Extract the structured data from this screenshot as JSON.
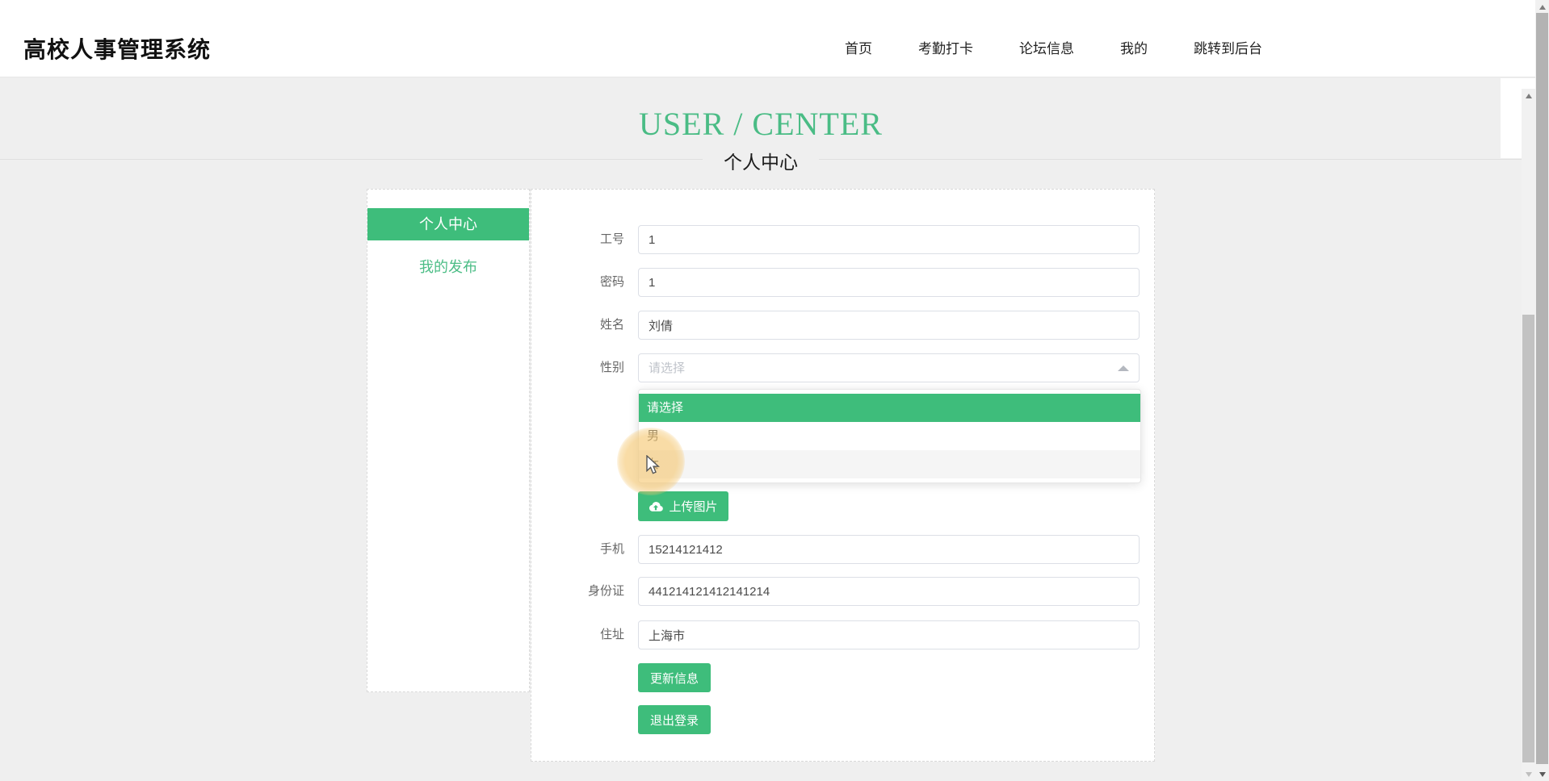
{
  "colors": {
    "accent_green": "#3ebd7b",
    "title_green": "#4abc85",
    "page_bg": "#efefef",
    "hover_option_bg": "#f5f5f5",
    "cursor_highlight": "#f5c770"
  },
  "header": {
    "logo": "高校人事管理系统",
    "nav": [
      {
        "label": "首页"
      },
      {
        "label": "考勤打卡"
      },
      {
        "label": "论坛信息"
      },
      {
        "label": "我的"
      },
      {
        "label": "跳转到后台"
      }
    ]
  },
  "banner": {
    "title": "USER / CENTER",
    "subtitle": "个人中心"
  },
  "sidebar": {
    "items": [
      {
        "label": "个人中心",
        "active": true
      },
      {
        "label": "我的发布",
        "active": false
      }
    ]
  },
  "form": {
    "rows": [
      {
        "label": "工号",
        "value": "1"
      },
      {
        "label": "密码",
        "value": "1"
      },
      {
        "label": "姓名",
        "value": "刘倩"
      },
      {
        "label": "手机",
        "value": "15214121412"
      },
      {
        "label": "身份证",
        "value": "441214121412141214"
      },
      {
        "label": "住址",
        "value": "上海市"
      }
    ],
    "gender": {
      "label": "性别",
      "placeholder": "请选择",
      "open": true,
      "options": [
        "请选择",
        "男",
        "女"
      ],
      "selected_option": "请选择",
      "hovered_option": "女"
    },
    "upload_button": "上传图片",
    "update_button": "更新信息",
    "logout_button": "退出登录"
  },
  "icons": {
    "upload": "cloud-upload-icon",
    "gender_arrow": "caret-up-icon",
    "cursor": "mouse-pointer-icon"
  }
}
